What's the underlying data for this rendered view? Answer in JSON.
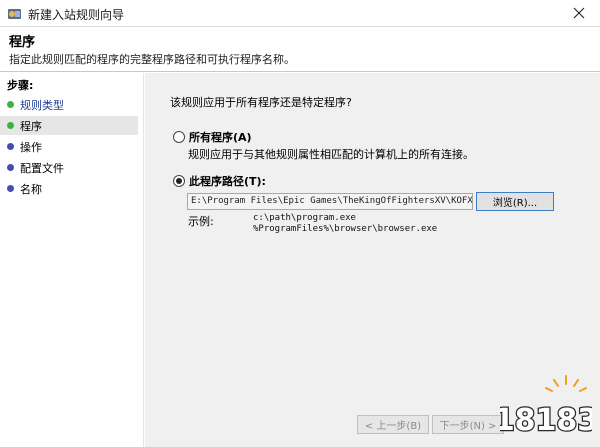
{
  "window": {
    "title": "新建入站规则向导"
  },
  "header": {
    "title": "程序",
    "description": "指定此规则匹配的程序的完整程序路径和可执行程序名称。"
  },
  "sidebar": {
    "steps_label": "步骤:",
    "items": [
      {
        "label": "规则类型",
        "state": "done"
      },
      {
        "label": "程序",
        "state": "active"
      },
      {
        "label": "操作",
        "state": "pending"
      },
      {
        "label": "配置文件",
        "state": "pending"
      },
      {
        "label": "名称",
        "state": "pending"
      }
    ]
  },
  "main": {
    "question": "该规则应用于所有程序还是特定程序?",
    "all_programs": {
      "label": "所有程序(A)",
      "description": "规则应用于与其他规则属性相匹配的计算机上的所有连接。",
      "checked": false
    },
    "this_program": {
      "label": "此程序路径(T):",
      "checked": true,
      "path_value": "E:\\Program Files\\Epic Games\\TheKingOfFightersXV\\KOFXV\\Bi",
      "browse_label": "浏览(R)..."
    },
    "example": {
      "label": "示例:",
      "lines": [
        "c:\\path\\program.exe",
        "%ProgramFiles%\\browser\\browser.exe"
      ]
    }
  },
  "footer": {
    "back_label": "< 上一步(B)",
    "next_label": "下一步(N) >"
  },
  "watermark": {
    "text": "18183"
  },
  "colors": {
    "step_done": "#3cb43c",
    "step_active": "#3cb43c",
    "step_pending": "#4a4ab4",
    "main_bg": "#f0f0f0",
    "browse_border": "#3c7fc6"
  }
}
